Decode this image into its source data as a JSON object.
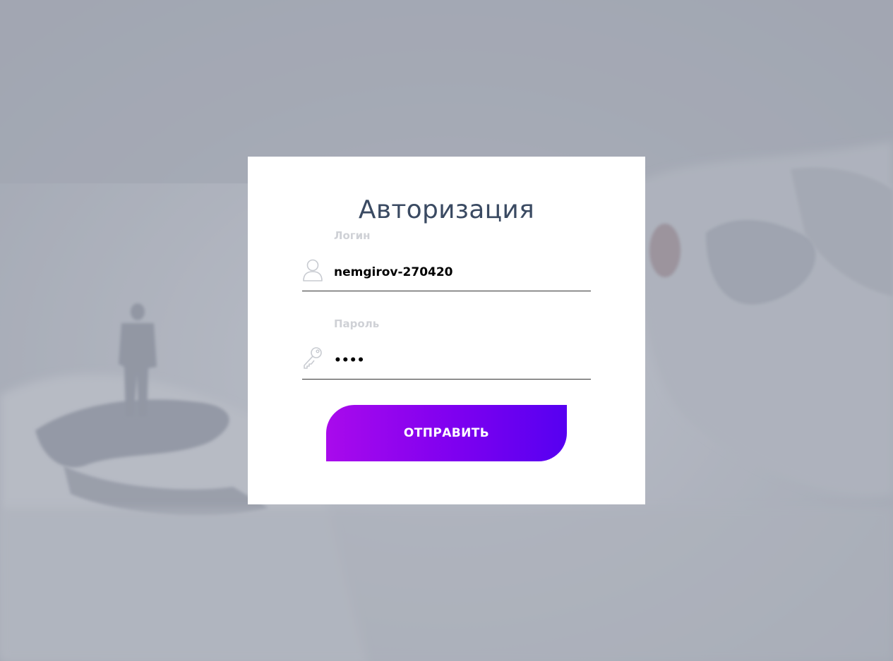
{
  "background": {
    "description_icon": "snowy-mountain-hiker-photo"
  },
  "form": {
    "title": "Авторизация",
    "login": {
      "label": "Логин",
      "value": "nemgirov-270420",
      "icon": "user-icon"
    },
    "password": {
      "label": "Пароль",
      "value": "....",
      "icon": "key-icon"
    },
    "submit_label": "ОТПРАВИТЬ"
  },
  "colors": {
    "title": "#3a4a62",
    "label": "#cfd1d6",
    "button_start": "#a90aec",
    "button_end": "#5600f1",
    "overlay": "#a0a6b2"
  }
}
